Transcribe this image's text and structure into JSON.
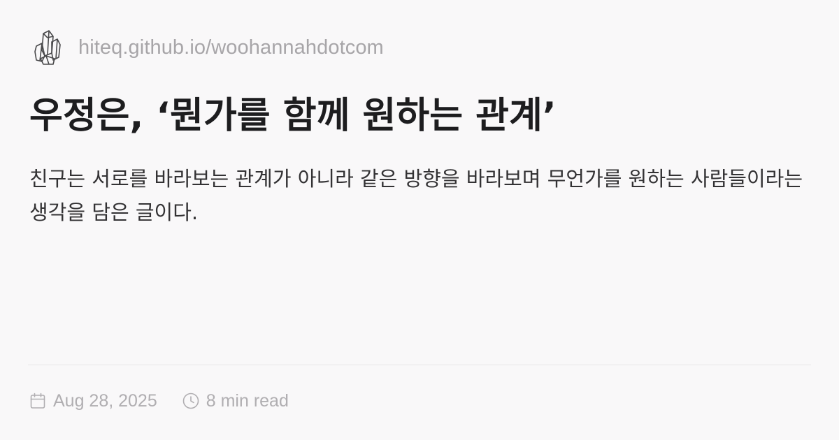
{
  "site": {
    "logo_icon": "crystal-logo-icon",
    "url": "hiteq.github.io/woohannahdotcom"
  },
  "post": {
    "title": "우정은, ‘뭔가를 함께 원하는 관계’",
    "summary": "친구는 서로를 바라보는 관계가 아니라 같은 방향을 바라보며 무언가를 원하는 사람들이라는 생각을 담은 글이다."
  },
  "meta": {
    "date_icon": "calendar-icon",
    "date": "Aug 28, 2025",
    "read_icon": "clock-icon",
    "read_time": "8 min read"
  },
  "colors": {
    "background": "#f9f8f9",
    "title": "#1d1d1f",
    "muted": "#b0aeb1",
    "divider": "#e8e6e8"
  }
}
